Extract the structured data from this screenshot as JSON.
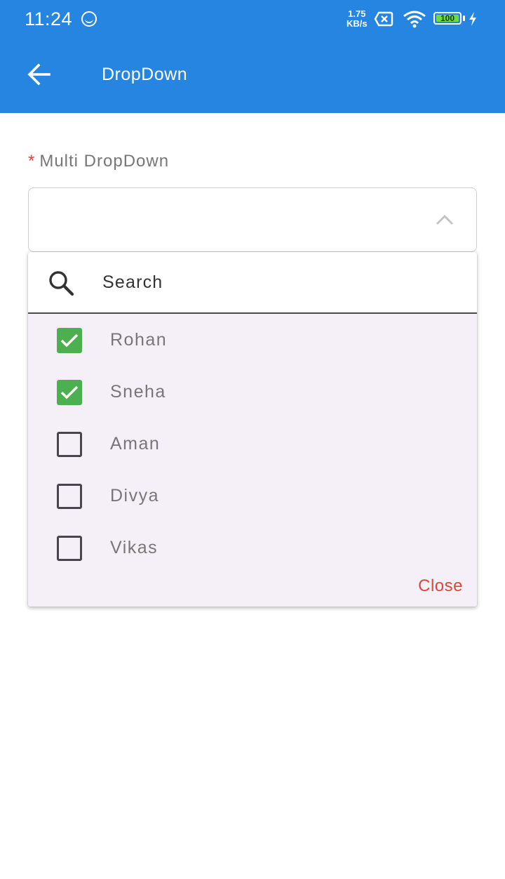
{
  "status_bar": {
    "time": "11:24",
    "net_speed_value": "1.75",
    "net_speed_unit": "KB/s",
    "battery": "100"
  },
  "app_bar": {
    "title": "DropDown",
    "back_icon": "arrow-left-icon",
    "color": "#2585e0"
  },
  "form": {
    "required_mark": "*",
    "field_label": "Multi DropDown",
    "dropdown_value": "",
    "dropdown_state": "expanded"
  },
  "dropdown_panel": {
    "search_placeholder": "Search",
    "options": [
      {
        "label": "Rohan",
        "checked": true
      },
      {
        "label": "Sneha",
        "checked": true
      },
      {
        "label": "Aman",
        "checked": false
      },
      {
        "label": "Divya",
        "checked": false
      },
      {
        "label": "Vikas",
        "checked": false
      }
    ],
    "close_label": "Close",
    "check_color": "#4caf50",
    "close_color": "#e0453a"
  }
}
